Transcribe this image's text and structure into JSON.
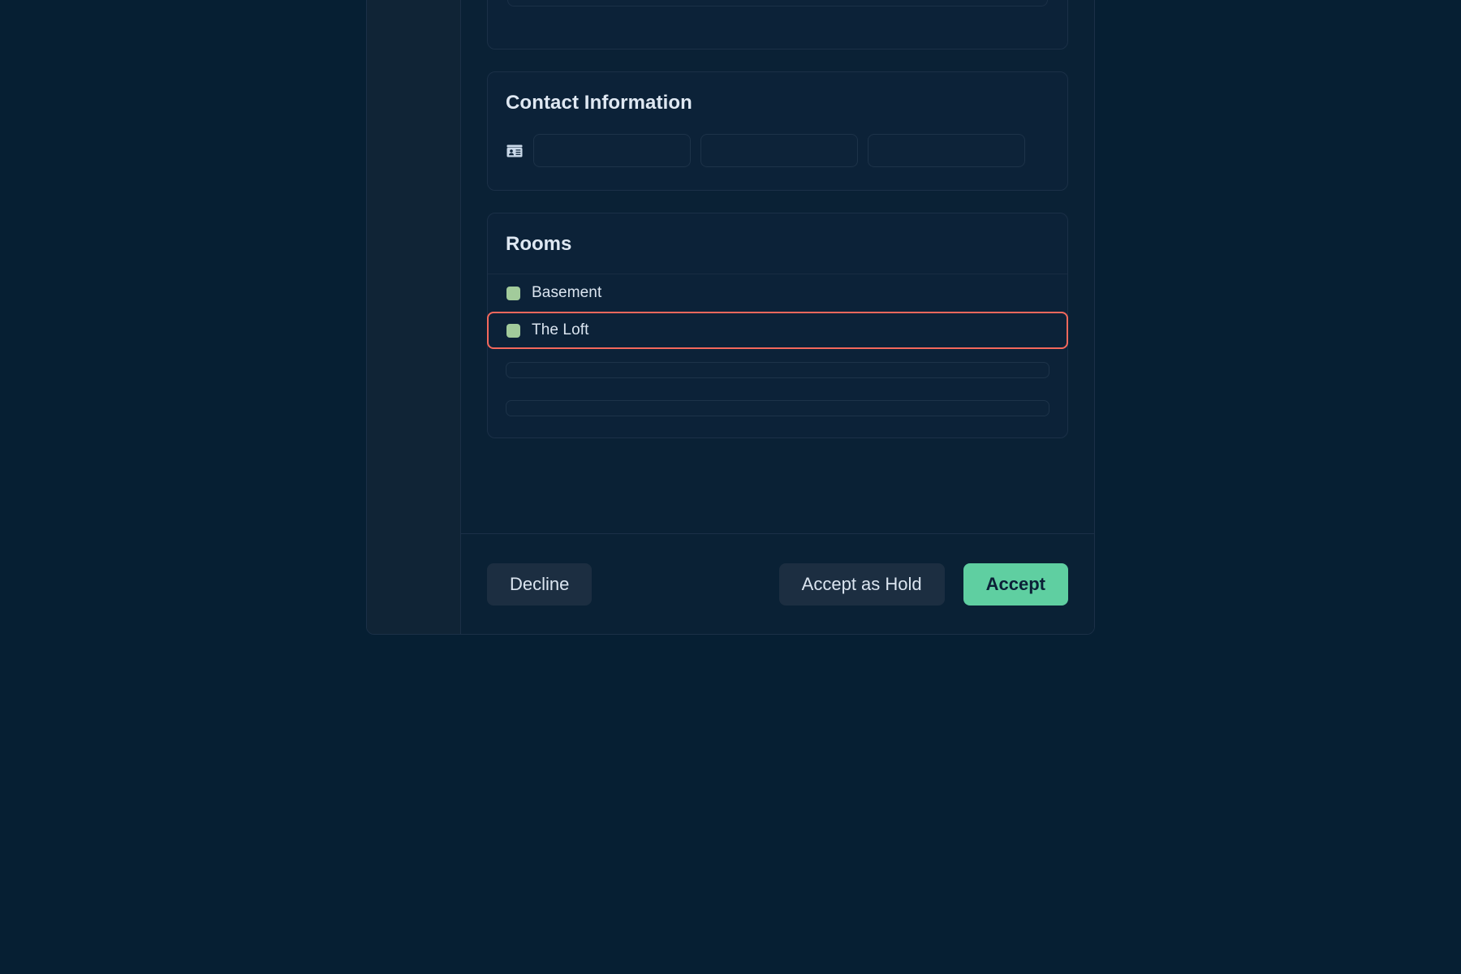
{
  "theme": {
    "page_background": "#061f33",
    "modal_background": "#0a2135",
    "sidebar_background": "#102436",
    "card_background": "#0c2238",
    "border": "#1b3047",
    "text_primary": "#dfe8f2",
    "accent_green": "#5fcfa1",
    "swatch_green": "#a2cb9b",
    "highlight_red": "#f4685c"
  },
  "modal": {
    "top_card": {
      "field_stub_label": ""
    },
    "contact": {
      "title": "Contact Information",
      "icon": "contact-card-icon",
      "inputs": [
        {
          "value": "",
          "placeholder": ""
        },
        {
          "value": "",
          "placeholder": ""
        },
        {
          "value": "",
          "placeholder": ""
        }
      ]
    },
    "rooms": {
      "title": "Rooms",
      "items": [
        {
          "label": "Basement",
          "swatch": "#a2cb9b",
          "selected": false
        },
        {
          "label": "The Loft",
          "swatch": "#a2cb9b",
          "selected": true
        }
      ],
      "empty_rows": 2
    },
    "footer": {
      "decline_label": "Decline",
      "accept_as_hold_label": "Accept as Hold",
      "accept_label": "Accept"
    }
  }
}
